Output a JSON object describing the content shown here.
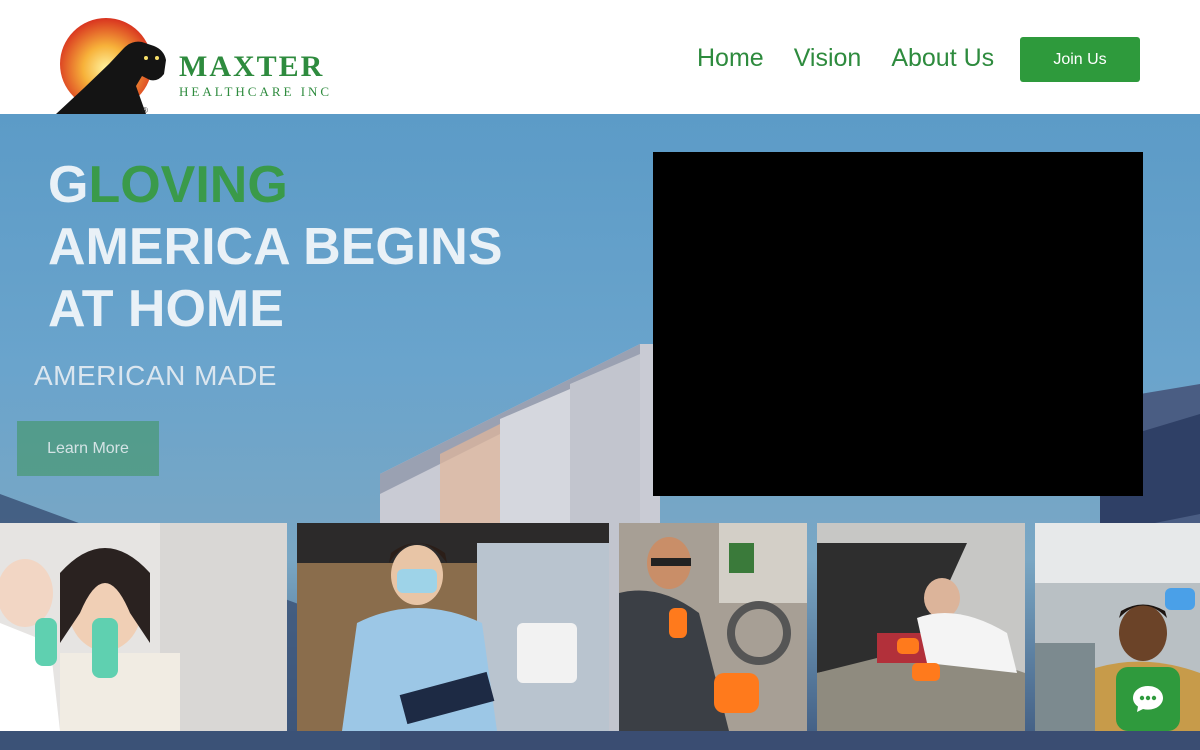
{
  "brand": {
    "name": "MAXTER",
    "tagline": "HEALTHCARE INC",
    "color": "#2e8b3e"
  },
  "nav": {
    "items": [
      {
        "label": "Home"
      },
      {
        "label": "Vision"
      },
      {
        "label": "About Us"
      }
    ]
  },
  "join_label": "Join Us",
  "hero": {
    "headline_g": "G",
    "headline_loving": "LOVING",
    "headline_line2": "AMERICA BEGINS",
    "headline_line3": "AT HOME",
    "subline": "AMERICAN MADE",
    "learn_more": "Learn More"
  },
  "photos": [
    {
      "name": "dentist-photo"
    },
    {
      "name": "nurse-photo"
    },
    {
      "name": "mechanic-photo"
    },
    {
      "name": "car-repair-photo"
    },
    {
      "name": "barber-photo"
    }
  ],
  "chat": {
    "icon": "chat-icon"
  },
  "colors": {
    "accent": "#2e9a3c",
    "video_bg": "#000000"
  }
}
